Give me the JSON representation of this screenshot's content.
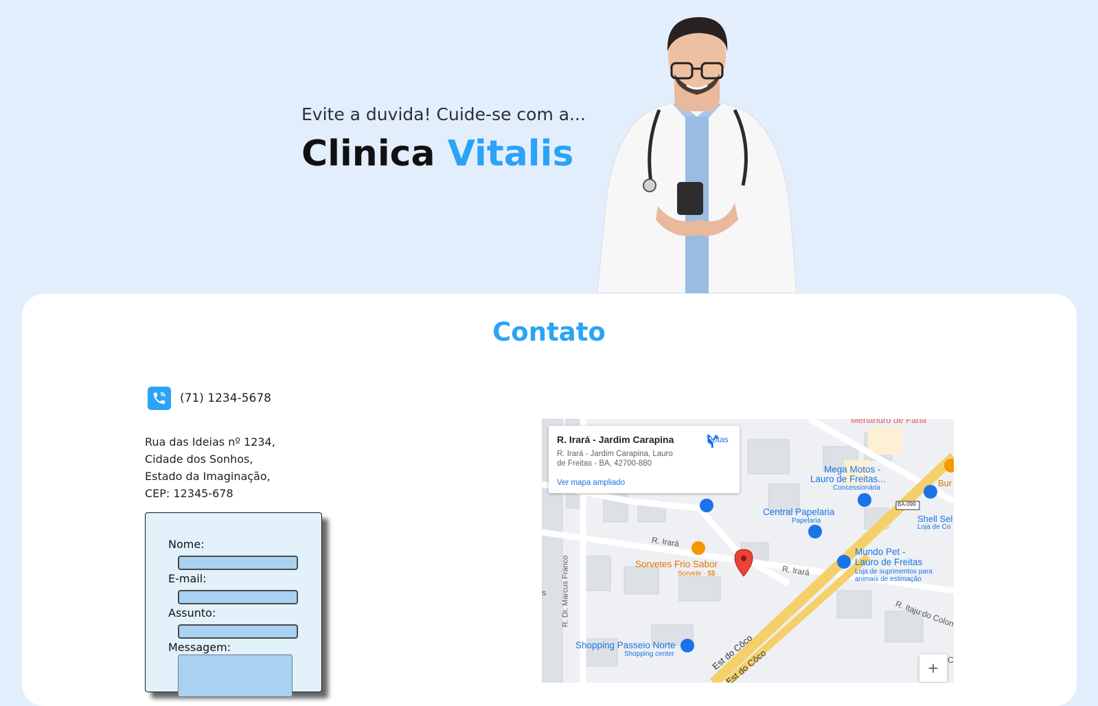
{
  "hero": {
    "kicker": "Evite a duvida! Cuide-se com a...",
    "title_main": "Clinica",
    "title_accent": "Vitalis",
    "accent_color": "#2ba3f6"
  },
  "contact": {
    "title": "Contato",
    "phone": "(71) 1234-5678",
    "phone_icon": "phone-icon",
    "address": [
      "Rua das Ideias nº 1234,",
      "Cidade dos Sonhos,",
      "Estado da Imaginação,",
      "CEP: 12345-678"
    ]
  },
  "form": {
    "name_label": "Nome:",
    "email_label": "E-mail:",
    "subject_label": "Assunto:",
    "message_label": "Messagem:"
  },
  "map": {
    "place_name": "R. Irará - Jardim Carapina",
    "place_address": "R. Irará - Jardim Carapina, Lauro de Freitas - BA, 42700-880",
    "directions_label": "Rotas",
    "larger_map_link": "Ver mapa ampliado",
    "zoom_in": "+",
    "labels": {
      "menandro": "Menandro de Faria",
      "mega_motos": "Mega Motos -",
      "mega_motos_2": "Lauro de Freitas...",
      "concessionaria": "Concessionária",
      "bur": "Bur",
      "central_papelaria": "Central Papelaria",
      "papelaria": "Papelaria",
      "shell": "Shell Sel",
      "loja_de_co": "Loja de Co",
      "ba099": "BA-099",
      "r_irara_1": "R. Irará",
      "r_irara_2": "R. Irará",
      "sorvetes": "Sorvetes Frio Sabor",
      "sorvete_price": "Sorvete · $$",
      "mundo_pet": "Mundo Pet -",
      "mundo_pet_2": "Lauro de Freitas",
      "mundo_pet_desc": "Loja de suprimentos para",
      "mundo_pet_desc2": "animais de estimação",
      "r_itaju": "R. Itaju do Colon",
      "marcus_franco": "R. Dr. Marcus Franco",
      "shopping": "Shopping Passeio Norte",
      "shopping_center": "Shopping center",
      "est_coco_1": "Est do Côco",
      "est_coco_2": "Est do Côco",
      "edge_s": "s",
      "edge_c": "C"
    }
  }
}
